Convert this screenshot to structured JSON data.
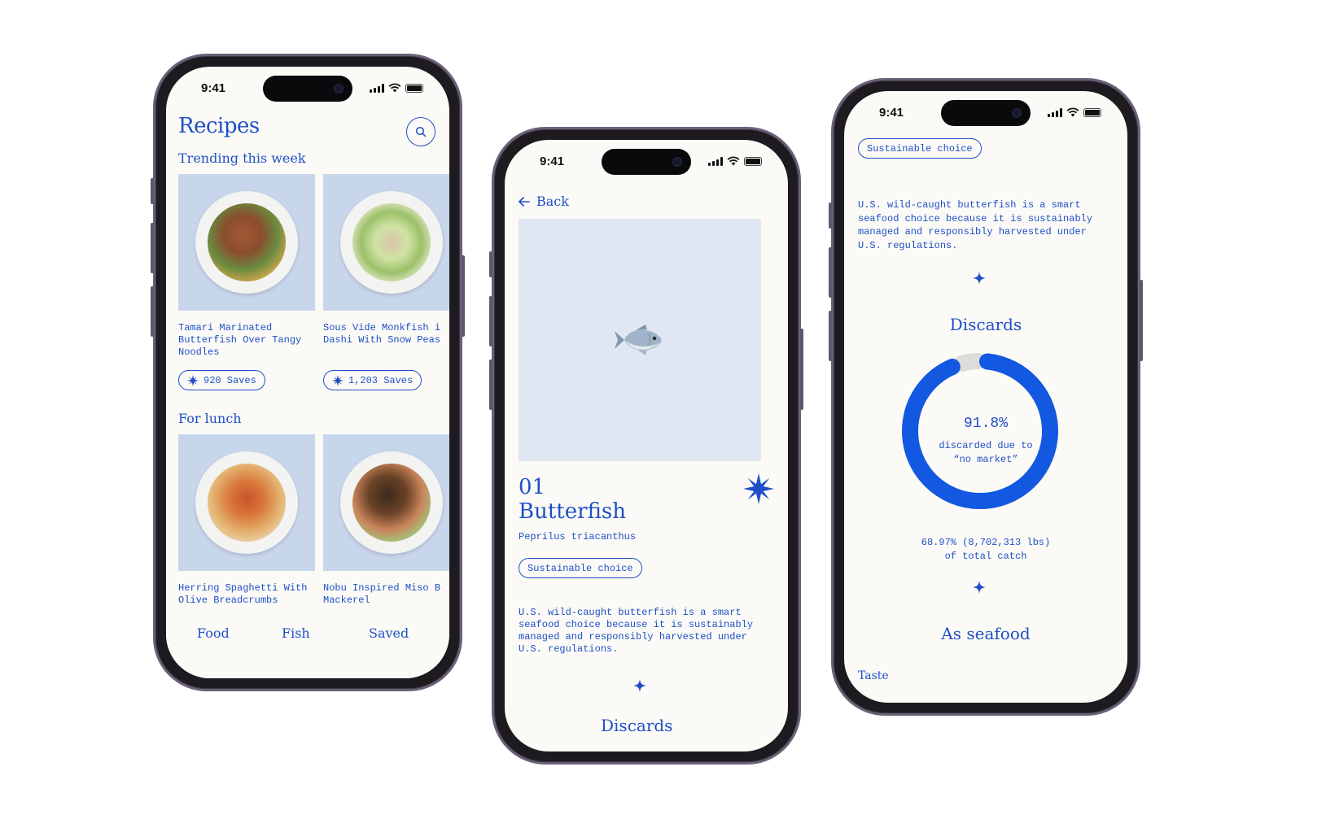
{
  "status": {
    "time": "9:41"
  },
  "recipes_screen": {
    "title": "Recipes",
    "sections": [
      {
        "heading": "Trending this week",
        "cards": [
          {
            "name": "Tamari Marinated\nButterfish Over Tangy\nNoodles",
            "saves": "920 Saves"
          },
          {
            "name": "Sous Vide Monkfish i\nDashi With Snow Peas",
            "saves": "1,203 Saves"
          }
        ]
      },
      {
        "heading": "For lunch",
        "cards": [
          {
            "name": "Herring Spaghetti With\nOlive Breadcrumbs",
            "saves": ""
          },
          {
            "name": "Nobu Inspired Miso B\nMackerel",
            "saves": ""
          }
        ]
      }
    ],
    "tabs": [
      "Food",
      "Fish",
      "Saved"
    ]
  },
  "fish_screen": {
    "back_label": "Back",
    "number": "01",
    "name": "Butterfish",
    "scientific_name": "Peprilus triacanthus",
    "badge": "Sustainable choice",
    "description": "U.S. wild-caught butterfish is a smart seafood choice because it is sustainably managed and responsibly harvested under U.S. regulations.",
    "cut_heading": "Discards"
  },
  "details_screen": {
    "badge": "Sustainable choice",
    "description": "U.S. wild-caught butterfish is a smart seafood choice because it is sustainably managed and responsibly harvested under U.S. regulations.",
    "discards_heading": "Discards",
    "discard_percent_label": "91.8%",
    "discard_fraction": 0.918,
    "discard_caption_1": "discarded due to",
    "discard_caption_2": "“no market”",
    "total_line_1": "68.97% (8,702,313 lbs)",
    "total_line_2": "of total catch",
    "seafood_heading": "As seafood",
    "taste_label": "Taste"
  },
  "colors": {
    "accent": "#1f4fc8",
    "donut": "#1358e0",
    "donut_track": "#dddcda",
    "background": "#fbfaf6",
    "card_bg": "#c8d6ec"
  }
}
